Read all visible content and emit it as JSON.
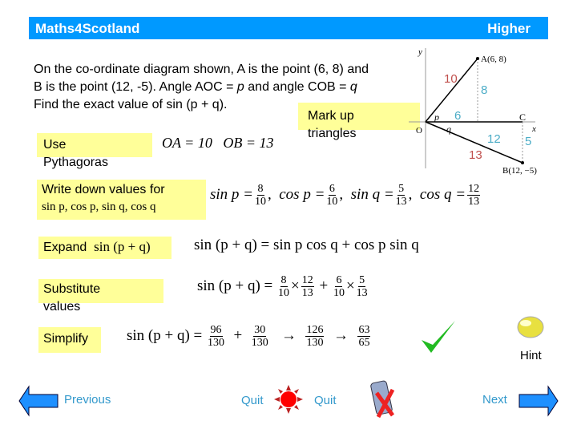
{
  "header": {
    "title": "Maths4Scotland",
    "level": "Higher"
  },
  "question": {
    "line1": "On the co-ordinate diagram shown, A is the point (6, 8) and",
    "line2": "B is the point (12, -5). Angle AOC = ",
    "p": "p",
    "line2b": " and angle COB = ",
    "q": "q",
    "line3": "Find the exact value of sin (p + q)."
  },
  "diagram": {
    "y": "y",
    "x": "x",
    "o": "O",
    "c": "C",
    "a": "A(6, 8)",
    "b": "B(12, −5)",
    "p": "p",
    "q": "q",
    "oa": "10",
    "ay": "8",
    "ox": "6",
    "ob": "13",
    "ocx": "12",
    "cb": "5",
    "colors": {
      "hyp": "#c0504d",
      "leg": "#4bacc6"
    }
  },
  "hints": {
    "mark": "Mark up triangles",
    "pyth": "Use Pythagoras",
    "pyth_eq": {
      "oa": "OA = 10",
      "ob": "OB = 13"
    },
    "write": "Write down values for",
    "write_math": "sin p, cos p, sin q, cos q",
    "expand": "Expand",
    "expand_math": "sin (p + q)",
    "subst": "Substitute values",
    "simplify": "Simplify"
  },
  "steps": {
    "values": [
      {
        "f": "sin p =",
        "n": "8",
        "d": "10"
      },
      {
        "f": "cos p =",
        "n": "6",
        "d": "10"
      },
      {
        "f": "sin q =",
        "n": "5",
        "d": "13"
      },
      {
        "f": "cos q =",
        "n": "12",
        "d": "13"
      }
    ],
    "expand": "sin (p + q) = sin p cos q + cos p sin q",
    "subst": {
      "lhs": "sin (p + q) =",
      "a": [
        "8",
        "10"
      ],
      "b": [
        "12",
        "13"
      ],
      "c": [
        "6",
        "10"
      ],
      "d": [
        "5",
        "13"
      ]
    },
    "simplify": {
      "lhs": "sin (p + q) =",
      "a": [
        "96",
        "130"
      ],
      "b": [
        "30",
        "130"
      ],
      "c": [
        "126",
        "130"
      ],
      "d": [
        "63",
        "65"
      ]
    }
  },
  "nav": {
    "previous": "Previous",
    "quit1": "Quit",
    "quit2": "Quit",
    "next": "Next",
    "hint": "Hint"
  },
  "colors": {
    "header": "#0099ff",
    "highlight": "#ffff99",
    "nav_text": "#3399cc",
    "arrow": "#1e90ff",
    "check": "#22bb22"
  }
}
